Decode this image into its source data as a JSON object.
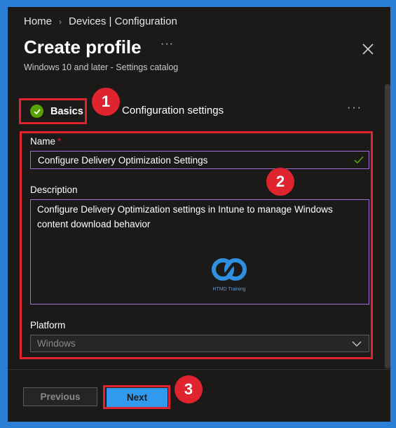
{
  "breadcrumb": {
    "home": "Home",
    "current": "Devices | Configuration"
  },
  "header": {
    "title": "Create profile",
    "more": "···",
    "subtitle": "Windows 10 and later - Settings catalog"
  },
  "tabs": {
    "basics": "Basics",
    "configuration": "Configuration settings",
    "more": "···"
  },
  "badges": {
    "one": "1",
    "two": "2",
    "three": "3"
  },
  "form": {
    "name_label": "Name",
    "required_mark": "*",
    "name_value": "Configure Delivery Optimization Settings",
    "description_label": "Description",
    "description_value": "Configure Delivery Optimization settings in Intune to manage Windows content download behavior",
    "platform_label": "Platform",
    "platform_value": "Windows"
  },
  "watermark": {
    "text": "HTMD Training"
  },
  "footer": {
    "previous": "Previous",
    "next": "Next"
  },
  "icons": {
    "basics_status": "check-circle-icon",
    "name_valid": "checkmark-icon",
    "close": "close-icon",
    "platform_dropdown": "chevron-down-icon"
  },
  "colors": {
    "annotation_red": "#e0242f",
    "primary_button": "#2f9af0",
    "success_green": "#57a300",
    "focus_border": "#9b72cf",
    "outer_background": "#2b7fd6"
  }
}
